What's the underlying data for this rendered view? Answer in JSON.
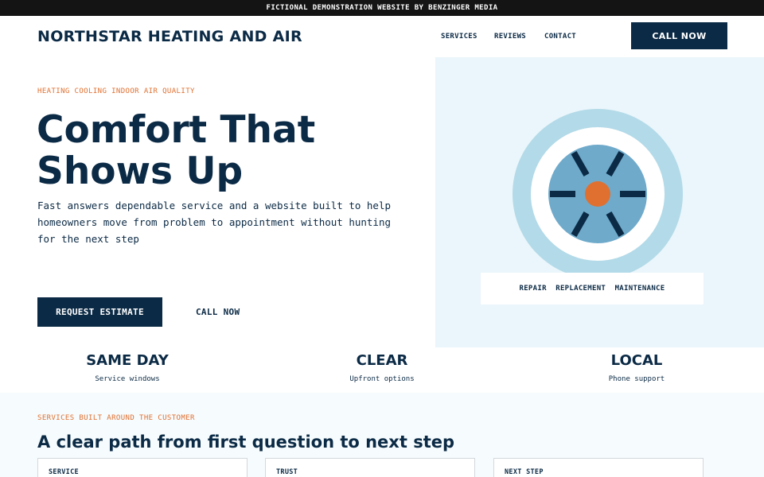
{
  "topbar": {
    "text": "FICTIONAL DEMONSTRATION WEBSITE BY BENZINGER MEDIA"
  },
  "header": {
    "brand": "NORTHSTAR HEATING AND AIR",
    "nav": [
      "SERVICES",
      "REVIEWS",
      "CONTACT"
    ],
    "cta": "CALL NOW"
  },
  "hero": {
    "eyebrow": "HEATING COOLING INDOOR AIR QUALITY",
    "title": "Comfort That Shows Up",
    "text": "Fast answers dependable service and a website built to help homeowners move from problem to appointment without hunting for the next step",
    "primary_button": "REQUEST ESTIMATE",
    "secondary_link": "CALL NOW",
    "panel_label": "REPAIR  REPLACEMENT  MAINTENANCE",
    "illustration_icon": "hvac-fan-icon"
  },
  "stats": [
    {
      "title": "SAME DAY",
      "sub": "Service windows"
    },
    {
      "title": "CLEAR",
      "sub": "Upfront options"
    },
    {
      "title": "LOCAL",
      "sub": "Phone support"
    }
  ],
  "services": {
    "eyebrow": "SERVICES BUILT AROUND THE CUSTOMER",
    "title": "A clear path from first question to next step",
    "cards": [
      "SERVICE",
      "TRUST",
      "NEXT STEP"
    ]
  },
  "colors": {
    "navy": "#0b2a45",
    "accent_orange": "#e07030",
    "panel_bg": "#eaf6fb",
    "ring_light": "#b3dae8",
    "ring_mid": "#6faacb"
  }
}
